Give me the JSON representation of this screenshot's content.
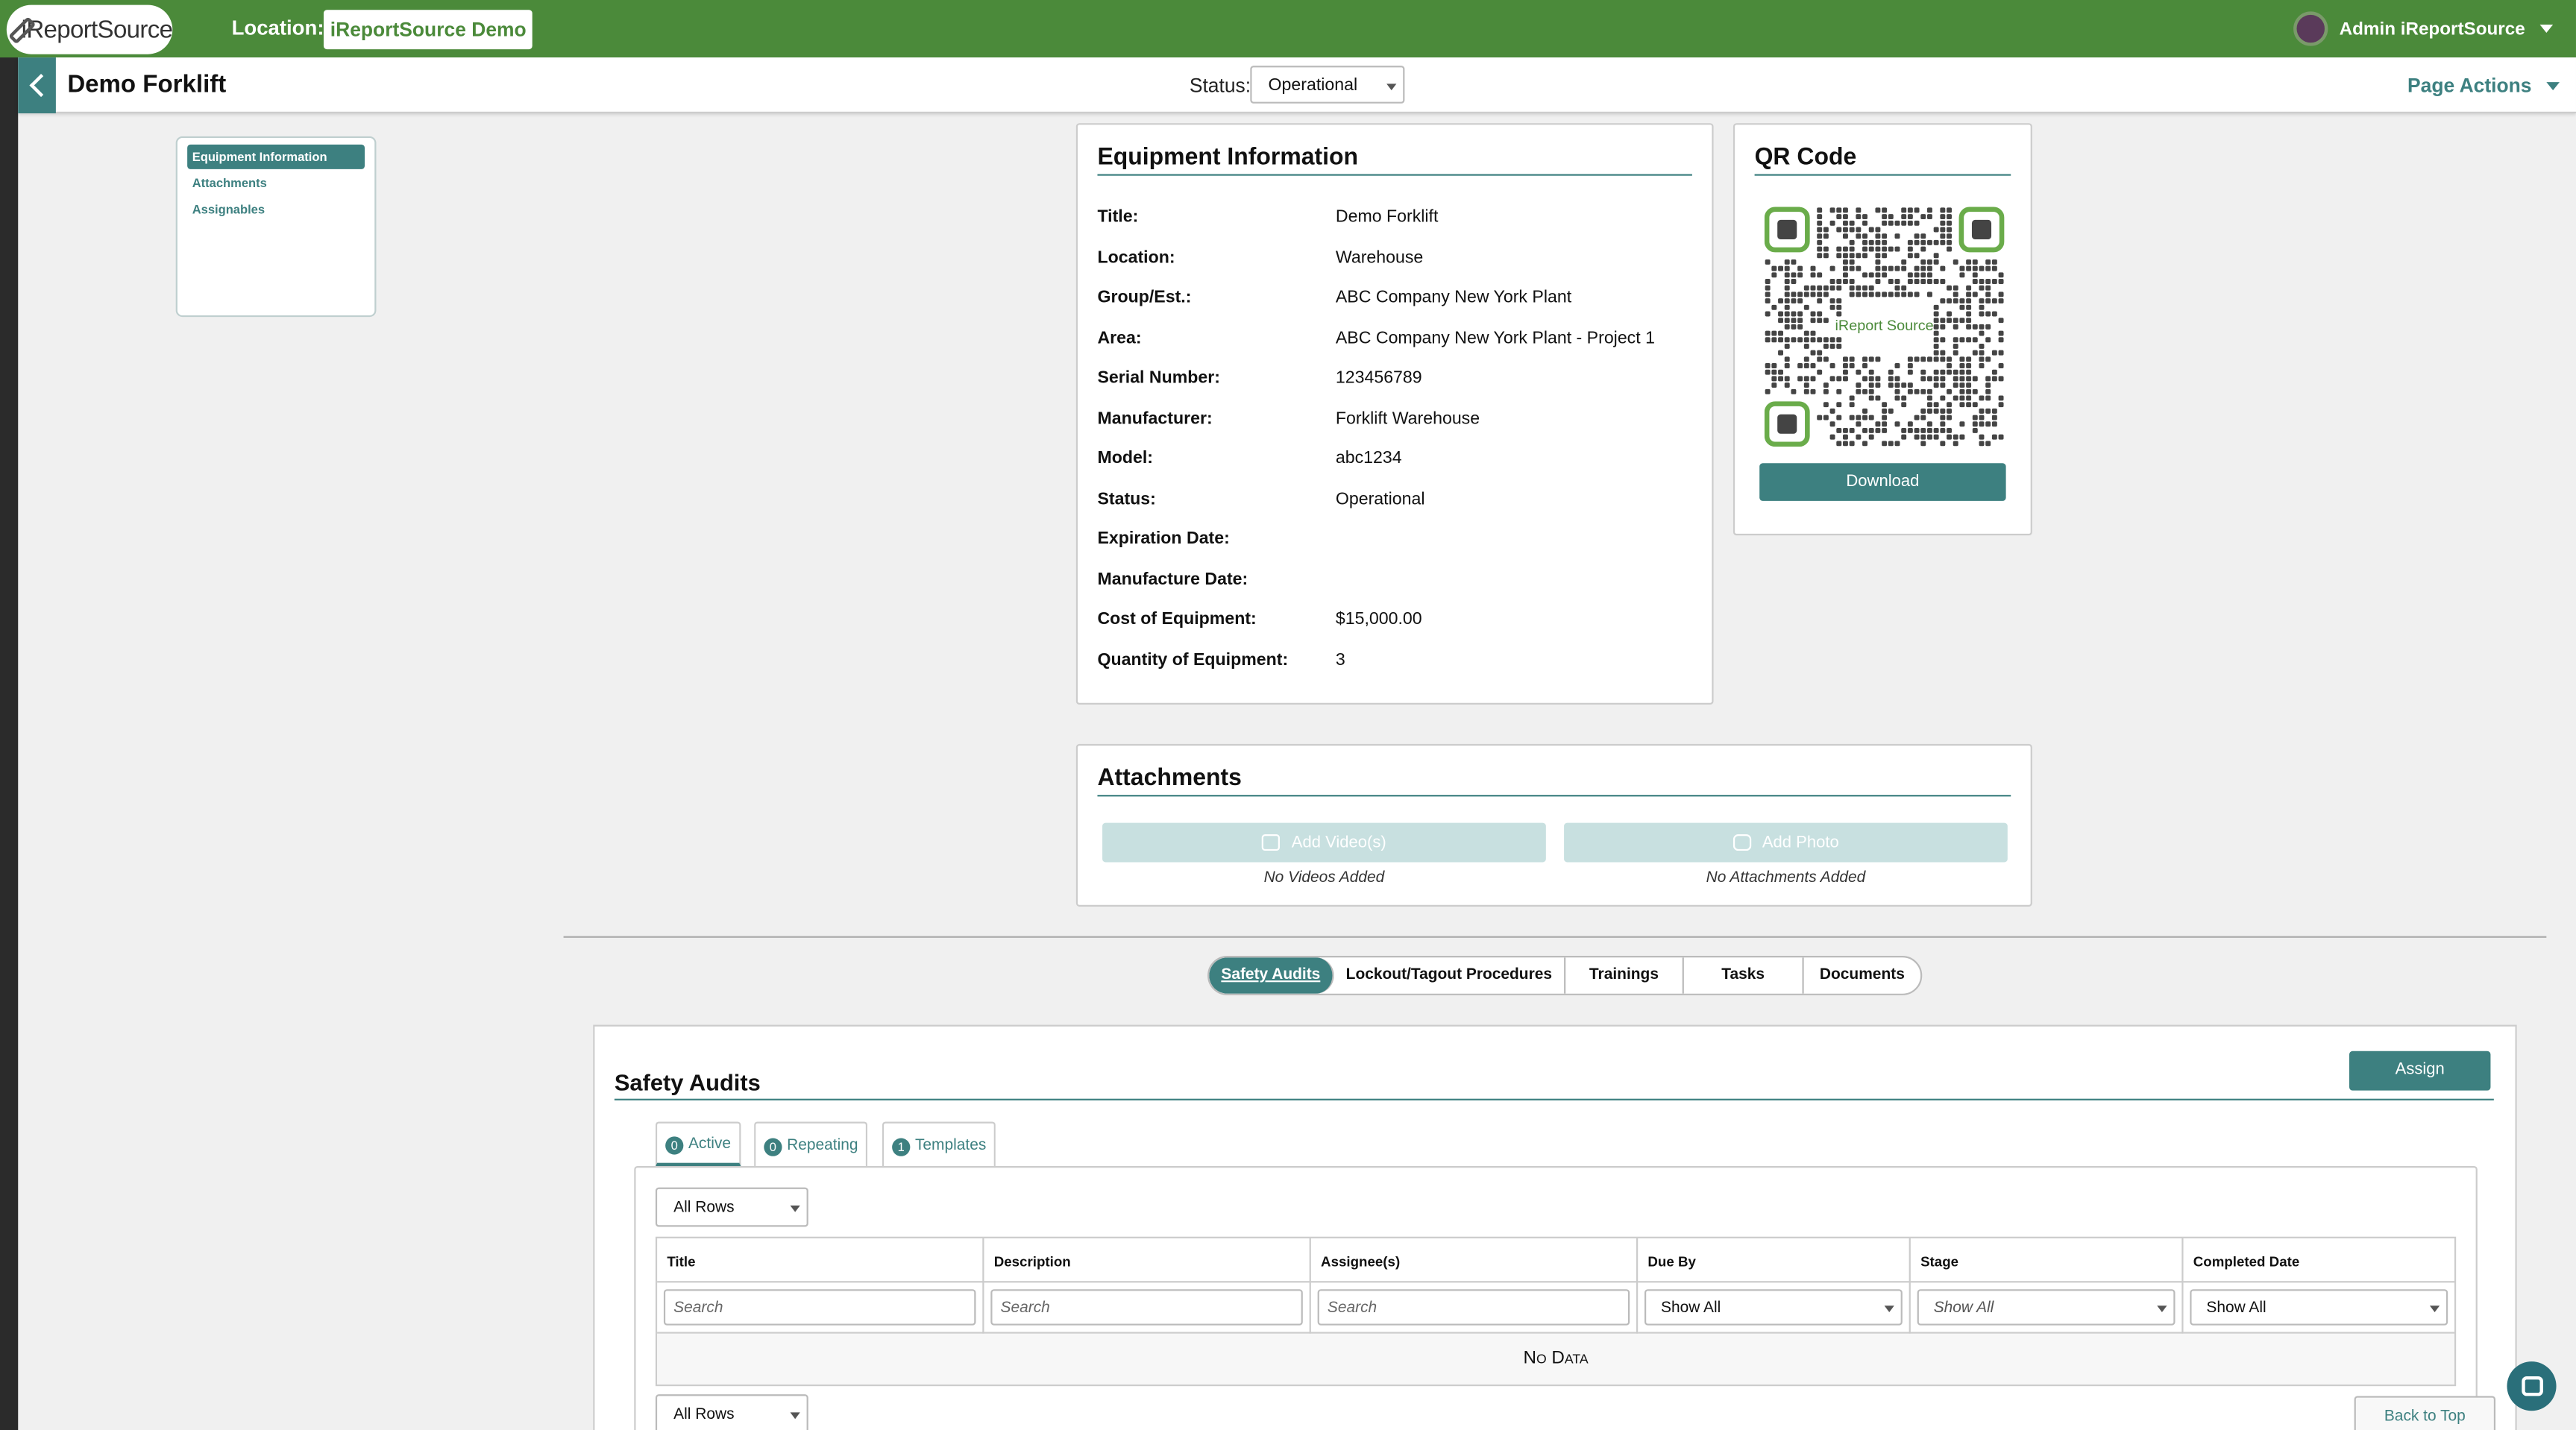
{
  "header": {
    "logo_text": "iReportSource",
    "location_label": "Location:",
    "location_value": "iReportSource Demo",
    "user_name": "Admin iReportSource"
  },
  "subheader": {
    "title": "Demo Forklift",
    "status_label": "Status:",
    "status_value": "Operational",
    "page_actions": "Page Actions"
  },
  "sidenav": {
    "items": [
      {
        "label": "Equipment Information"
      },
      {
        "label": "Attachments"
      },
      {
        "label": "Assignables"
      }
    ]
  },
  "equipment": {
    "title": "Equipment Information",
    "fields": [
      {
        "label": "Title:",
        "value": "Demo Forklift"
      },
      {
        "label": "Location:",
        "value": "Warehouse"
      },
      {
        "label": "Group/Est.:",
        "value": "ABC Company New York Plant"
      },
      {
        "label": "Area:",
        "value": "ABC Company New York Plant - Project 1"
      },
      {
        "label": "Serial Number:",
        "value": "123456789"
      },
      {
        "label": "Manufacturer:",
        "value": "Forklift Warehouse"
      },
      {
        "label": "Model:",
        "value": "abc1234"
      },
      {
        "label": "Status:",
        "value": "Operational"
      },
      {
        "label": "Expiration Date:",
        "value": ""
      },
      {
        "label": "Manufacture Date:",
        "value": ""
      },
      {
        "label": "Cost of Equipment:",
        "value": "$15,000.00"
      },
      {
        "label": "Quantity of Equipment:",
        "value": "3"
      }
    ]
  },
  "qr": {
    "title": "QR Code",
    "download_label": "Download",
    "logo_text": "iReport Source"
  },
  "attachments": {
    "title": "Attachments",
    "add_video_label": "Add Video(s)",
    "add_photo_label": "Add Photo",
    "no_videos": "No Videos Added",
    "no_attachments": "No Attachments Added"
  },
  "tabs": [
    {
      "label": "Safety Audits"
    },
    {
      "label": "Lockout/Tagout Procedures"
    },
    {
      "label": "Trainings"
    },
    {
      "label": "Tasks"
    },
    {
      "label": "Documents"
    }
  ],
  "audits": {
    "title": "Safety Audits",
    "assign_label": "Assign",
    "subtabs": [
      {
        "count": "0",
        "label": "Active"
      },
      {
        "count": "0",
        "label": "Repeating"
      },
      {
        "count": "1",
        "label": "Templates"
      }
    ],
    "rows_select": "All Rows",
    "columns": [
      "Title",
      "Description",
      "Assignee(s)",
      "Due By",
      "Stage",
      "Completed Date"
    ],
    "search_placeholder": "Search",
    "filter_show_all": "Show All",
    "no_data": "No Data",
    "back_to_top": "Back to Top"
  },
  "colors": {
    "header_green": "#4b8a3a",
    "accent_teal": "#3d8080"
  }
}
